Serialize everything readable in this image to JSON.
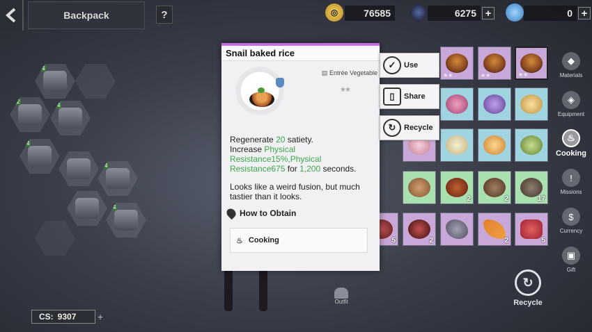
{
  "header": {
    "title": "Backpack",
    "help_label": "?",
    "back_icon": "back-arrow-icon"
  },
  "currencies": [
    {
      "icon": "gold-coin-icon",
      "value": "76585"
    },
    {
      "icon": "crystal-icon",
      "value": "6275"
    },
    {
      "icon": "diamond-icon",
      "value": "0"
    }
  ],
  "item": {
    "name": "Snail baked rice",
    "category": "Entrée Vegetable",
    "desc_prefix": "Regenerate",
    "satiety_value": "20",
    "satiety_suffix": "satiety.",
    "increase_word": "Increase",
    "buff_line1": "Physical",
    "buff_line2": "Resistance15%,Physical",
    "buff_line3": "Resistance675",
    "for_word": "for",
    "duration": "1,200",
    "seconds_word": "seconds.",
    "flavor_line1": "Looks like a weird fusion, but much",
    "flavor_line2": "tastier than it looks.",
    "how_to_obtain": "How to Obtain",
    "obtain_source": "Cooking"
  },
  "actions": [
    "Use",
    "Share",
    "Recycle"
  ],
  "side_menu": [
    {
      "label": "Materials",
      "icon": "materials-icon"
    },
    {
      "label": "Equipment",
      "icon": "equipment-icon"
    },
    {
      "label": "Cooking",
      "icon": "cooking-icon"
    },
    {
      "label": "Missions",
      "icon": "missions-icon"
    },
    {
      "label": "Currency",
      "icon": "currency-icon"
    },
    {
      "label": "Gift",
      "icon": "gift-icon"
    }
  ],
  "grid_counts": {
    "row4_col3": "2",
    "row4_col5": "2",
    "row4_col6": "17",
    "row5_col1": "5",
    "row5_col2": "2",
    "row5_col4": "2",
    "row5_col5": "5"
  },
  "bottom": {
    "cs_label": "CS:",
    "cs_value": "9307",
    "recycle_label": "Recycle",
    "outfit_label": "Outfit"
  },
  "colors": {
    "rarity_bar": "#c56ee0",
    "green_text": "#3aa84a"
  }
}
